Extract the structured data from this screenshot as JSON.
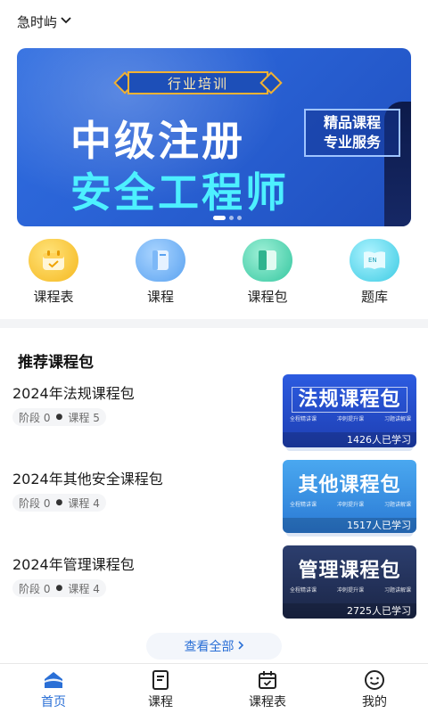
{
  "location": {
    "label": "急时屿",
    "chevron_icon": "chevron-down-icon"
  },
  "banner": {
    "tag": "行业培训",
    "title_line1": "中级注册",
    "title_line2": "安全工程师",
    "side_line1": "精品课程",
    "side_line2": "专业服务",
    "active_dot": 1,
    "dot_count": 3
  },
  "quick_nav": [
    {
      "label": "课程表",
      "icon": "calendar-icon"
    },
    {
      "label": "课程",
      "icon": "book-icon"
    },
    {
      "label": "课程包",
      "icon": "package-icon"
    },
    {
      "label": "题库",
      "icon": "question-bank-icon"
    }
  ],
  "section_title": "推荐课程包",
  "courses": [
    {
      "name": "2024年法规课程包",
      "stage_label": "阶段",
      "stage": "0",
      "course_label": "课程",
      "course_count": "5",
      "thumb_title": "法规课程包",
      "bullets": [
        "全程精讲课",
        "冲刺提升课",
        "习题讲解课"
      ],
      "learners": "1426人已学习"
    },
    {
      "name": "2024年其他安全课程包",
      "stage_label": "阶段",
      "stage": "0",
      "course_label": "课程",
      "course_count": "4",
      "thumb_title": "其他课程包",
      "bullets": [
        "全程精讲课",
        "冲刺提升课",
        "习题讲解课"
      ],
      "learners": "1517人已学习"
    },
    {
      "name": "2024年管理课程包",
      "stage_label": "阶段",
      "stage": "0",
      "course_label": "课程",
      "course_count": "4",
      "thumb_title": "管理课程包",
      "bullets": [
        "全程精讲课",
        "冲刺提升课",
        "习题讲解课"
      ],
      "learners": "2725人已学习"
    }
  ],
  "view_all": "查看全部",
  "tabs": [
    {
      "label": "首页",
      "icon": "home-icon",
      "active": true
    },
    {
      "label": "课程",
      "icon": "course-icon",
      "active": false
    },
    {
      "label": "课程表",
      "icon": "schedule-icon",
      "active": false
    },
    {
      "label": "我的",
      "icon": "profile-icon",
      "active": false
    }
  ],
  "colors": {
    "accent": "#2a6fd6",
    "banner_blue": "#2a63d6",
    "banner_cyan": "#4df0ff"
  }
}
